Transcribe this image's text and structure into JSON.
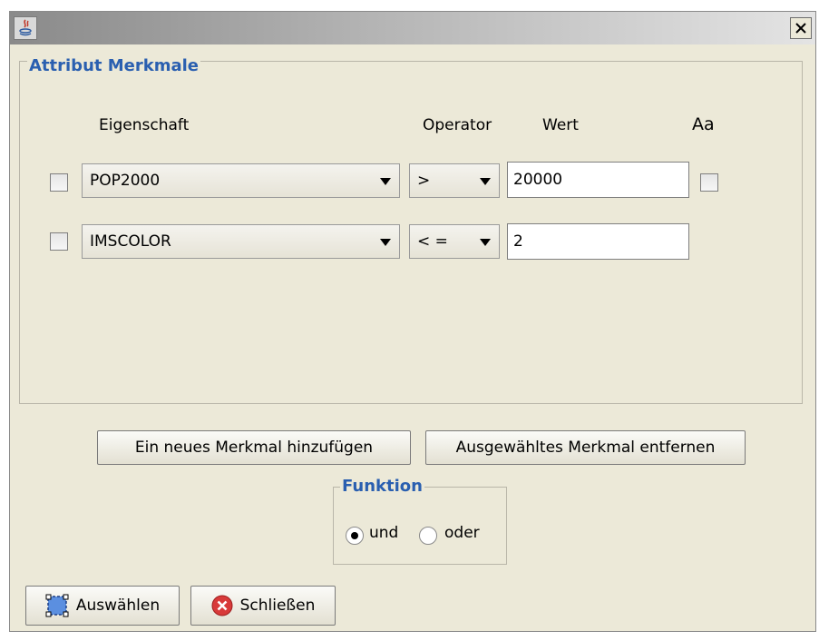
{
  "window": {
    "title": ""
  },
  "attribute_group": {
    "title": "Attribut Merkmale",
    "headers": {
      "property": "Eigenschaft",
      "operator": "Operator",
      "value": "Wert",
      "case": "Aa"
    },
    "rows": [
      {
        "checked": false,
        "property": "POP2000",
        "operator": ">",
        "value": "20000",
        "case_checked": false
      },
      {
        "checked": false,
        "property": "IMSCOLOR",
        "operator": "< =",
        "value": "2"
      }
    ]
  },
  "buttons": {
    "add": "Ein neues Merkmal hinzufügen",
    "remove": "Ausgewähltes Merkmal entfernen",
    "select": "Auswählen",
    "close": "Schließen"
  },
  "function_group": {
    "title": "Funktion",
    "options": [
      {
        "label": "und",
        "selected": true
      },
      {
        "label": "oder",
        "selected": false
      }
    ]
  },
  "colors": {
    "legend": "#2a5fb0",
    "close_icon": "#d83a3a",
    "select_icon": "#3a73d8"
  }
}
